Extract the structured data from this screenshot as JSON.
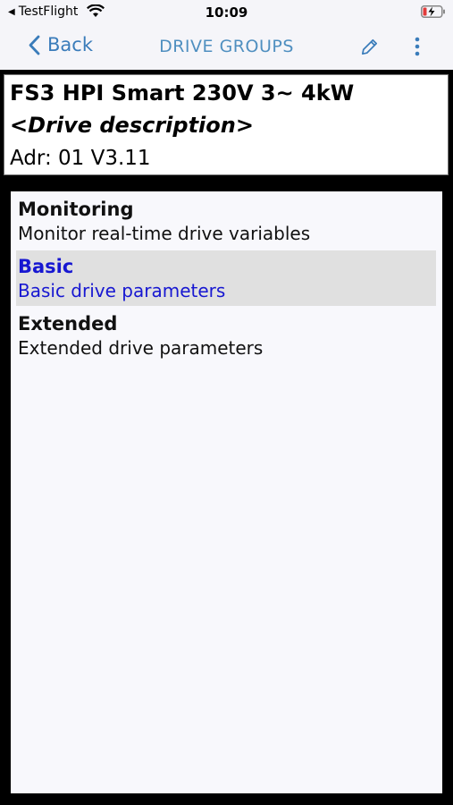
{
  "status_bar": {
    "back_app": "TestFlight",
    "time": "10:09"
  },
  "nav": {
    "back_label": "Back",
    "title": "DRIVE GROUPS",
    "accent_color": "#3a7cba"
  },
  "drive": {
    "name": "FS3 HPI Smart 230V 3~ 4kW",
    "description": "<Drive description>",
    "address": "Adr: 01 V3.11"
  },
  "groups": [
    {
      "title": "Monitoring",
      "subtitle": "Monitor real-time drive variables",
      "selected": false
    },
    {
      "title": "Basic",
      "subtitle": "Basic drive parameters",
      "selected": true
    },
    {
      "title": "Extended",
      "subtitle": "Extended drive parameters",
      "selected": false
    }
  ],
  "icons": [
    "back-triangle-icon",
    "wifi-icon",
    "battery-charging-icon",
    "chevron-left-icon",
    "pencil-icon",
    "more-vertical-icon"
  ]
}
